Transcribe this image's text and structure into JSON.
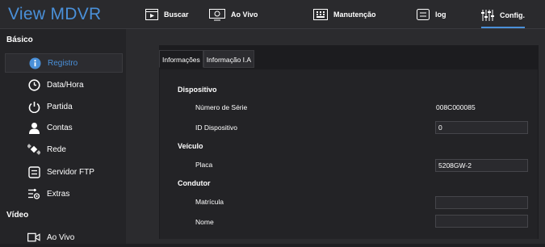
{
  "header": {
    "brand": "View MDVR",
    "nav": [
      {
        "label": "Buscar",
        "icon": "film-play-icon"
      },
      {
        "label": "Ao Vivo",
        "icon": "camera-icon"
      },
      {
        "label": "Manutenção",
        "icon": "keypad-icon"
      },
      {
        "label": "log",
        "icon": "list-icon"
      },
      {
        "label": "Config.",
        "icon": "sliders-icon",
        "active": true
      }
    ]
  },
  "sidebar": {
    "sections": [
      {
        "label": "Básico"
      },
      {
        "label": "Vídeo"
      }
    ],
    "items": [
      {
        "label": "Registro",
        "icon": "info-icon",
        "active": true
      },
      {
        "label": "Data/Hora",
        "icon": "clock-icon"
      },
      {
        "label": "Partida",
        "icon": "power-icon"
      },
      {
        "label": "Contas",
        "icon": "user-icon"
      },
      {
        "label": "Rede",
        "icon": "satellite-icon"
      },
      {
        "label": "Servidor FTP",
        "icon": "server-icon"
      },
      {
        "label": "Extras",
        "icon": "settings-sliders-icon"
      },
      {
        "label": "Ao Vivo",
        "icon": "video-camera-icon"
      }
    ]
  },
  "tabs": [
    {
      "label": "Informações",
      "active": true
    },
    {
      "label": "Informação I.A",
      "active": false
    }
  ],
  "form": {
    "dispositivo": {
      "title": "Dispositivo",
      "serial_label": "Número de Série",
      "serial_value": "008C000085",
      "id_label": "ID Dispositivo",
      "id_value": "0"
    },
    "veiculo": {
      "title": "Veículo",
      "placa_label": "Placa",
      "placa_value": "5208GW-2"
    },
    "condutor": {
      "title": "Condutor",
      "matricula_label": "Matrícula",
      "matricula_value": "",
      "nome_label": "Nome",
      "nome_value": ""
    }
  },
  "colors": {
    "accent": "#4a90d9",
    "background": "#1f1f22",
    "panel": "#232326"
  }
}
